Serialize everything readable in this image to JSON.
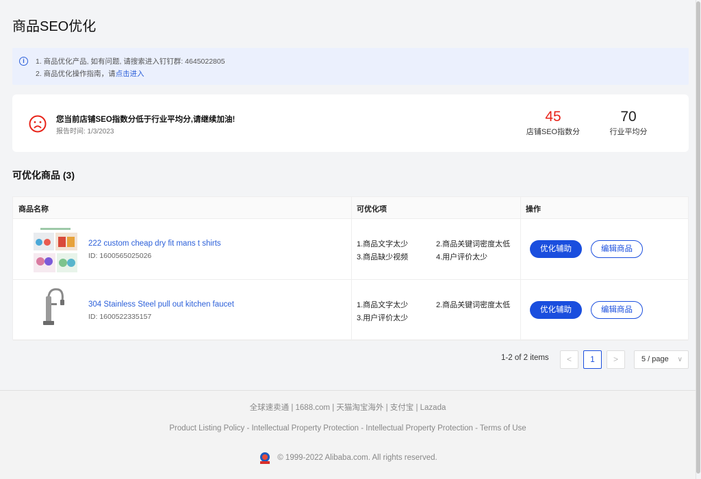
{
  "page": {
    "title": "商品SEO优化"
  },
  "notice": {
    "line1": "1. 商品优化产品, 如有问题, 请搜索进入钉钉群: 4645022805",
    "line2_prefix": "2. 商品优化操作指南，请",
    "line2_link": "点击进入"
  },
  "score": {
    "message": "您当前店铺SEO指数分低于行业平均分,请继续加油!",
    "report_date": "报告时间: 1/3/2023",
    "shop_score": "45",
    "shop_label": "店铺SEO指数分",
    "industry_score": "70",
    "industry_label": "行业平均分",
    "shop_color": "#e8241a"
  },
  "section": {
    "title": "可优化商品 (3)"
  },
  "table": {
    "headers": [
      "商品名称",
      "可优化项",
      "操作"
    ],
    "rows": [
      {
        "name": "222 custom cheap dry fit mans t shirts",
        "id": "ID: 1600565025026",
        "issues": [
          "1.商品文字太少",
          "2.商品关键词密度太低",
          "3.商品缺少视频",
          "4.用户评价太少"
        ],
        "action_primary": "优化辅助",
        "action_secondary": "编辑商品"
      },
      {
        "name": "304 Stainless Steel pull out kitchen faucet",
        "id": "ID: 1600522335157",
        "issues": [
          "1.商品文字太少",
          "2.商品关键词密度太低",
          "3.用户评价太少"
        ],
        "action_primary": "优化辅助",
        "action_secondary": "编辑商品"
      }
    ]
  },
  "pagination": {
    "total": "1-2 of 2 items",
    "prev": "<",
    "current": "1",
    "next": ">",
    "page_size": "5 / page"
  },
  "footer": {
    "links": "全球速卖通 | 1688.com | 天猫淘宝海外 | 支付宝 | Lazada",
    "policies": "Product Listing Policy - Intellectual Property Protection - Intellectual Property Protection - Terms of Use",
    "copyright": "© 1999-2022 Alibaba.com. All rights reserved."
  },
  "colors": {
    "accent": "#1a4ede",
    "link": "#2b5fd9",
    "danger": "#e8241a"
  },
  "icons": {
    "notice": "info-icon",
    "score": "sad-face-icon",
    "page_size": "chevron-down-icon"
  }
}
